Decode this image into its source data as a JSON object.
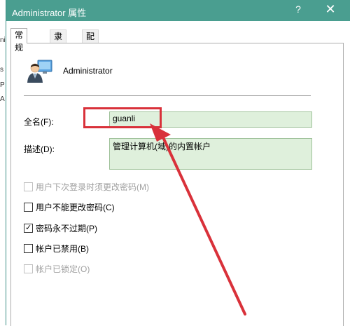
{
  "dialog": {
    "title": "Administrator 属性",
    "help_label": "?",
    "close_label": "✕"
  },
  "background_edge": [
    "ni",
    "s",
    "P",
    "A"
  ],
  "tabs": [
    {
      "label": "常规"
    },
    {
      "label": "隶属于"
    },
    {
      "label": "配置文件"
    }
  ],
  "account": {
    "name": "Administrator",
    "icon": "user-account-icon"
  },
  "fullname": {
    "label": "全名(F):",
    "value": "guanli"
  },
  "description": {
    "label": "描述(D):",
    "value": "管理计算机(域)的内置帐户"
  },
  "checkboxes": [
    {
      "label": "用户下次登录时须更改密码(M)",
      "checked": false,
      "disabled": true
    },
    {
      "label": "用户不能更改密码(C)",
      "checked": false,
      "disabled": false
    },
    {
      "label": "密码永不过期(P)",
      "checked": true,
      "disabled": false
    },
    {
      "label": "帐户已禁用(B)",
      "checked": false,
      "disabled": false
    },
    {
      "label": "帐户已锁定(O)",
      "checked": false,
      "disabled": true
    }
  ],
  "colors": {
    "titlebar": "#4a9e90",
    "field_bg": "#dff0dc",
    "annotation": "#d9313a"
  }
}
